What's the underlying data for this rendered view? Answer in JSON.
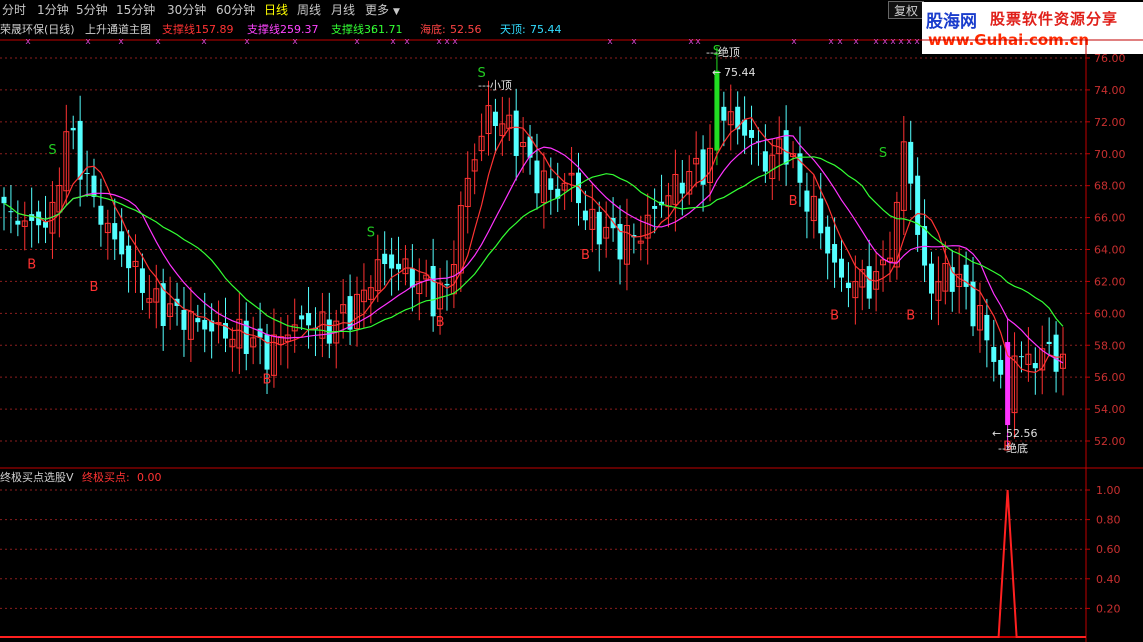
{
  "toolbar": {
    "tabs": [
      "分时",
      "1分钟",
      "5分钟",
      "15分钟",
      "30分钟",
      "60分钟",
      "日线",
      "周线",
      "月线",
      "更多"
    ],
    "active_tab": "日线",
    "more_arrow": "▼",
    "fuquan_label": "复权"
  },
  "logo": {
    "name": "股海网",
    "slogan": "股票软件资源分享",
    "url": "www.Guhai.com.cn"
  },
  "colors": {
    "support1": "#ff3333",
    "support2": "#ff33ff",
    "support3": "#33ff33",
    "haidi": "#ff4444",
    "tianding": "#33ddff",
    "up": "#ff3232",
    "down": "#54ffff",
    "grid": "#8b1e1e",
    "axis": "#c00000",
    "buy": "#ff3232",
    "sell": "#22cc22"
  },
  "main_title": {
    "stock": "荣晟环保(日线)",
    "indicator": "上升通道主图",
    "support1_label": "支撑线1:",
    "support1_value": "57.89",
    "support2_label": "支撑线2:",
    "support2_value": "59.37",
    "support3_label": "支撑线3:",
    "support3_value": "61.71",
    "haidi_label": "海底:",
    "haidi_value": "52.56",
    "tianding_label": "天顶:",
    "tianding_value": "75.44"
  },
  "price_axis": {
    "labels": [
      "76.00",
      "74.00",
      "72.00",
      "70.00",
      "68.00",
      "66.00",
      "64.00",
      "62.00",
      "60.00",
      "58.00",
      "56.00",
      "54.00",
      "52.00"
    ],
    "min": 52.0,
    "max": 76.0
  },
  "annotations": {
    "small_top": "---小顶",
    "abs_top": "---绝顶",
    "abs_top_value": "75.44",
    "abs_bottom_value": "52.56",
    "abs_bottom": "--绝底",
    "s_mark": "S",
    "b_mark": "B",
    "x_mark": "x"
  },
  "indicator_panel": {
    "name": "终极买点选股V",
    "line_label": "终极买点:",
    "line_value": "0.00",
    "labels": [
      "1.00",
      "0.80",
      "0.60",
      "0.40",
      "0.20"
    ],
    "spike_value": 1.0
  }
}
